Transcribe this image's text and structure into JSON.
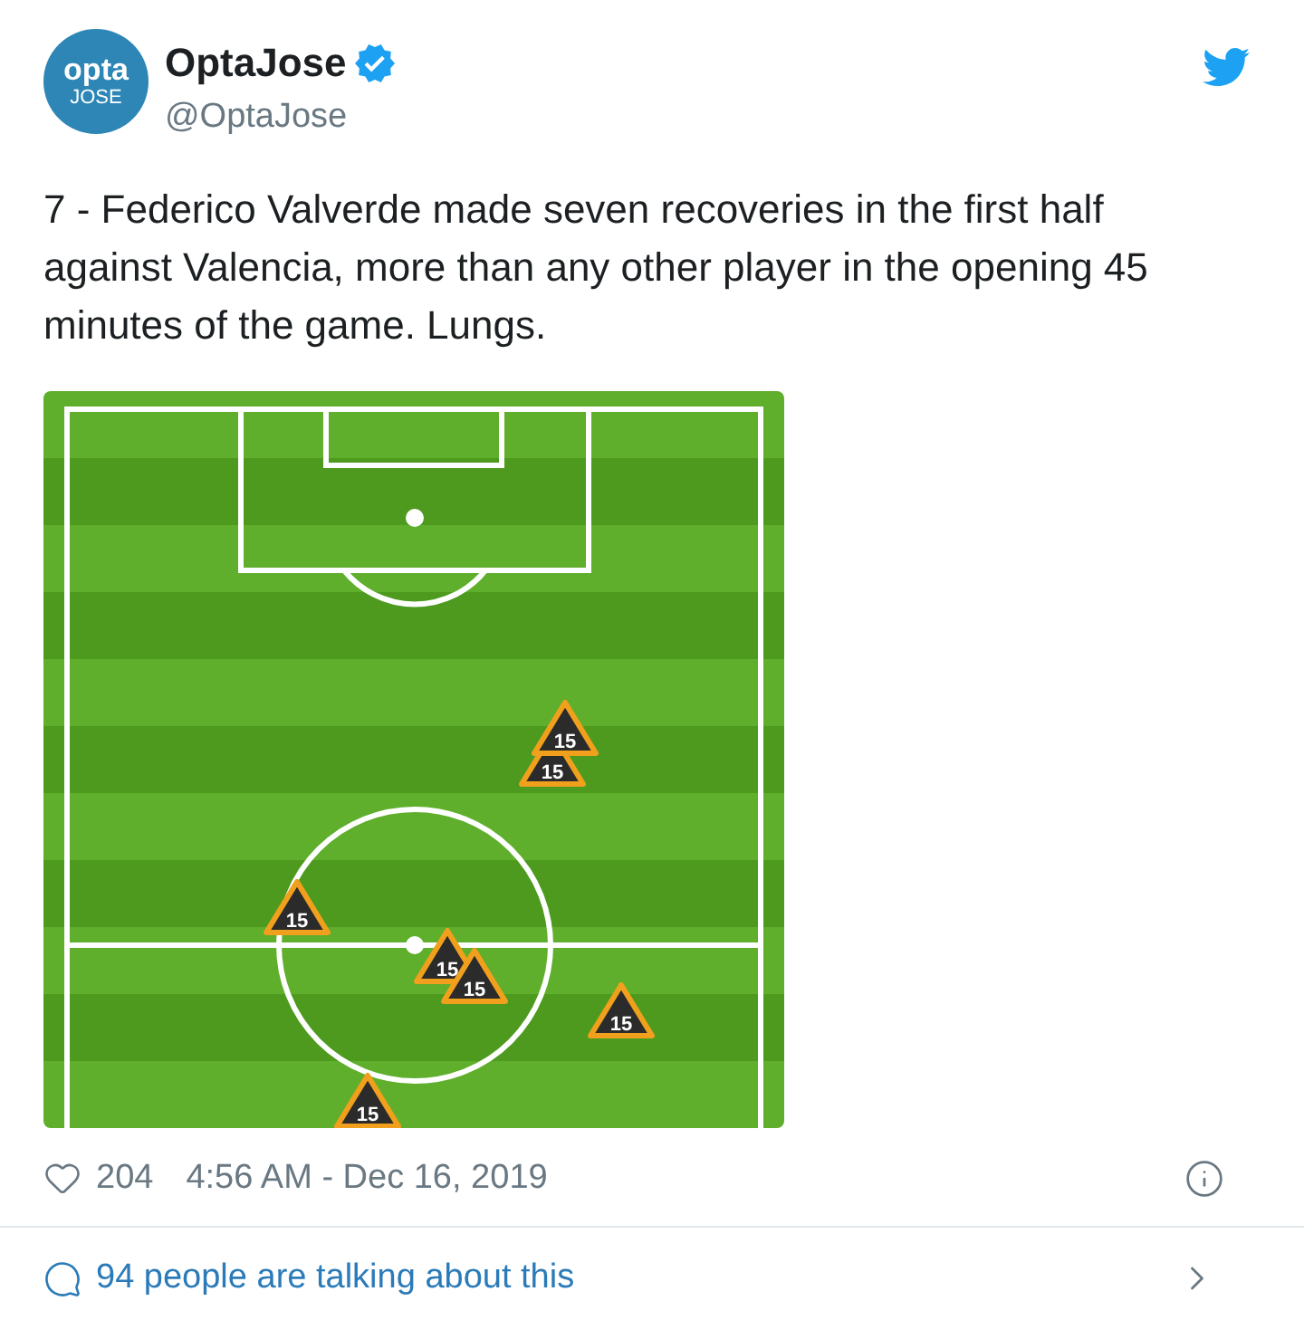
{
  "author": {
    "name": "OptaJose",
    "handle": "@OptaJose",
    "verified": true,
    "avatar": {
      "line_1": "opta",
      "line_2": "JOSE"
    }
  },
  "text": "7 - Federico Valverde made seven recoveries in the first half against Valencia, more than any other player in the opening 45 minutes of the game. Lungs.",
  "media": {
    "markers": [
      {
        "label": "15"
      },
      {
        "label": "15"
      },
      {
        "label": "15"
      },
      {
        "label": "15"
      },
      {
        "label": "15"
      },
      {
        "label": "15"
      },
      {
        "label": "15"
      }
    ]
  },
  "likes": "204",
  "timestamp": "4:56 AM - Dec 16, 2019",
  "conversation": "94 people are talking about this"
}
